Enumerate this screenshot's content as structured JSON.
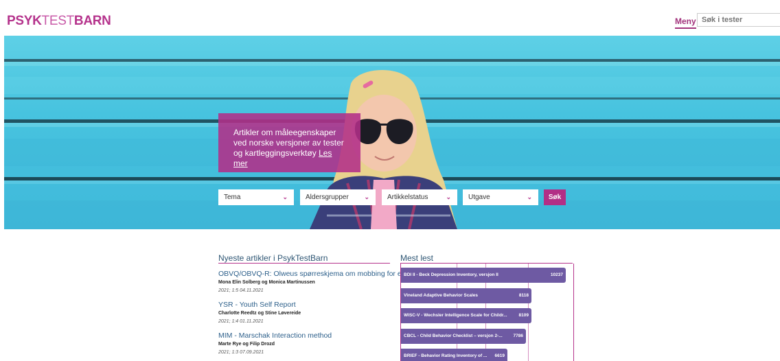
{
  "header": {
    "logo": {
      "part1": "PSYK",
      "part2": "TEST",
      "part3": "BARN"
    },
    "menu_label": "Meny",
    "search_placeholder": "Søk i tester"
  },
  "hero": {
    "promo_text": "Artikler om måleegenskaper ved norske versjoner av tester og kartleggingsverktøy",
    "promo_link": "Les mer",
    "filters": [
      {
        "label": "Tema"
      },
      {
        "label": "Aldersgrupper"
      },
      {
        "label": "Artikkelstatus"
      },
      {
        "label": "Utgave"
      }
    ],
    "search_button": "Søk"
  },
  "newest": {
    "title": "Nyeste artikler i PsykTestBarn",
    "articles": [
      {
        "title": "OBVQ/OBVQ-R: Olweus spørreskjema om mobbing for elever",
        "authors": "Mona Elin Solberg og Monica Martinussen",
        "meta": "2021; 1:5 04.11.2021"
      },
      {
        "title": "YSR - Youth Self Report",
        "authors": "Charlotte Reedtz og Stine Løvereide",
        "meta": "2021; 1:4 01.11.2021"
      },
      {
        "title": "MIM - Marschak Interaction method",
        "authors": "Marte Rye og Filip Drozd",
        "meta": "2021; 1:3 07.09.2021"
      }
    ]
  },
  "most_read": {
    "title": "Mest lest"
  },
  "chart_data": {
    "type": "bar",
    "orientation": "horizontal",
    "categories": [
      "BDI II - Beck Depression Inventory, versjon II",
      "Vineland Adaptive Behavior Scales",
      "WISC-V - Wechsler Intelligence Scale for Childr...",
      "CBCL - Child Behavior Checklist – versjon 2-...",
      "BRIEF - Behavior Rating Inventory of ..."
    ],
    "values": [
      10237,
      8118,
      8109,
      7786,
      6619
    ],
    "xlim": [
      0,
      10500
    ],
    "grid": true,
    "bar_color": "#6e5aa3"
  },
  "colors": {
    "brand": "#b5338c",
    "accent_purple": "#6e5aa3",
    "link": "#2c5f8a"
  }
}
